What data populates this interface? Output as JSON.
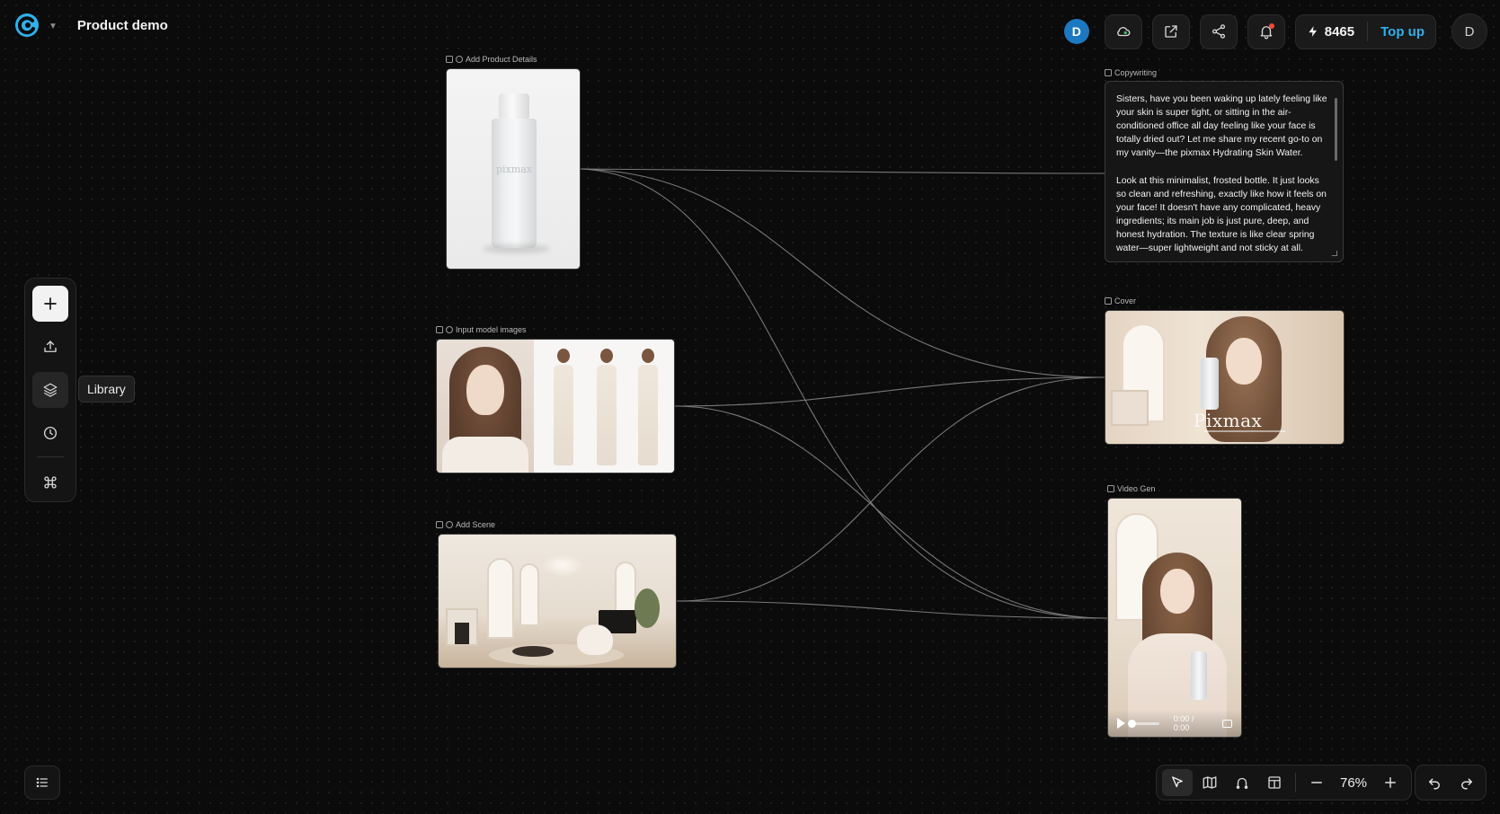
{
  "header": {
    "project_title": "Product demo",
    "user_initial": "D"
  },
  "topbar": {
    "credits": "8465",
    "topup_label": "Top up",
    "account_initial": "D",
    "has_notification": true
  },
  "rail": {
    "tooltip": "Library"
  },
  "nodes": {
    "product": {
      "label": "Add Product Details",
      "brand": "pixmax"
    },
    "models": {
      "label": "Input model images"
    },
    "scene": {
      "label": "Add Scene"
    },
    "copywriting": {
      "label": "Copywriting",
      "text": "Sisters, have you been waking up lately feeling like your skin is super tight, or sitting in the air-conditioned office all day feeling like your face is totally dried out? Let me share my recent go-to on my vanity—the pixmax Hydrating Skin Water.\n\nLook at this minimalist, frosted bottle. It just looks so clean and refreshing, exactly like how it feels on your face! It doesn't have any complicated, heavy ingredients; its main job is just pure, deep, and honest hydration. The texture is like clear spring water—super lightweight and not sticky at all."
    },
    "cover": {
      "label": "Cover",
      "title": "Pixmax"
    },
    "video": {
      "label": "Video Gen",
      "time": "0:00 / 0:00"
    }
  },
  "zoom": {
    "level": "76%"
  },
  "colors": {
    "accent": "#2fb1ea",
    "avatar": "#1c78c0",
    "notification": "#f04a3c",
    "canvas": "#0b0b0b"
  }
}
